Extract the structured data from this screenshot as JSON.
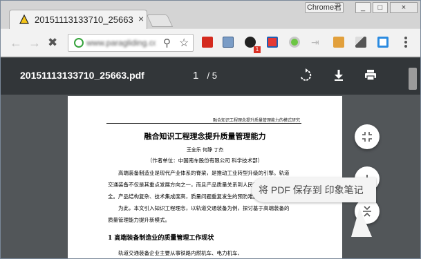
{
  "browser": {
    "tab_title": "20151113133710_25663",
    "tab_close": "×",
    "profile_label": "Chrome君",
    "window_min": "_",
    "window_max": "□",
    "window_close": "×",
    "url_text": "www.paragliding.com/data"
  },
  "pdf": {
    "filename": "20151113133710_25663.pdf",
    "current_page": "1",
    "total_pages": "/ 5"
  },
  "document": {
    "running_header": "融合知识工程理念提升质量管理能力的模式研究",
    "title": "融合知识工程理念提升质量管理能力",
    "authors": "王全乐  何静  丁杰",
    "affiliation": "（作者单位：中国南车股份有限公司  科学技术部）",
    "paragraphs": [
      "高端装备制造业是现代产业体系的脊梁，是推动工业转型升级的引擎。轨道",
      "交通装备不仅是其重点发展方向之一，而且产品质量关系到人民群众生命财产安",
      "全。产品结构复杂、技术集成度高，质量问题重复发生的预防难度大。",
      "为此，本文引入知识工程理念，以轨道交通装备为例，探讨基于高端装备的",
      "质量管理能力提升新模式。"
    ],
    "section_heading": "1  高端装备制造业的质量管理工作现状",
    "section_body": "轨道交通装备企业主要从事铁路内燃机车、电力机车、"
  },
  "toast": {
    "text": "将 PDF 保存到 印象笔记"
  },
  "icons": {
    "favicon": "pdf-triangle-icon",
    "fit_page": "fit-page-icon",
    "zoom_in": "zoom-in-icon",
    "zoom_out": "zoom-out-icon",
    "rotate": "rotate-icon",
    "download": "download-icon",
    "print": "print-icon"
  },
  "colors": {
    "pdf_toolbar": "#323639",
    "viewer_bg": "#525659",
    "secure_icon": "#36a33c"
  }
}
